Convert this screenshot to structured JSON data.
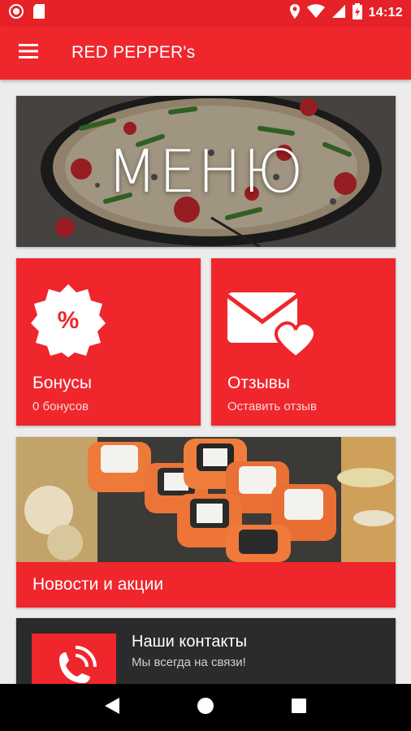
{
  "status_bar": {
    "time": "14:12",
    "icons": [
      "notification-icon",
      "sim-card-icon",
      "location-icon",
      "wifi-icon",
      "signal-icon",
      "battery-icon"
    ]
  },
  "app_bar": {
    "title": "RED PEPPER's",
    "menu_icon": "hamburger-icon"
  },
  "menu_card": {
    "title": "МЕНЮ"
  },
  "bonus_tile": {
    "title": "Бонусы",
    "subtitle": "0 бонусов",
    "icon": "percent-badge-icon",
    "icon_text": "%"
  },
  "reviews_tile": {
    "title": "Отзывы",
    "subtitle": "Оставить отзыв",
    "icon": "envelope-heart-icon"
  },
  "news_card": {
    "label": "Новости и акции"
  },
  "contacts_card": {
    "title": "Наши контакты",
    "subtitle": "Мы всегда на связи!",
    "icon": "phone-ringing-icon"
  },
  "nav_bar": {
    "icons": [
      "back-icon",
      "home-icon",
      "recents-icon"
    ]
  },
  "colors": {
    "brand_red": "#f0262d",
    "status_red": "#e62228",
    "background": "#ececec",
    "dark_card": "#2a2b2c"
  }
}
